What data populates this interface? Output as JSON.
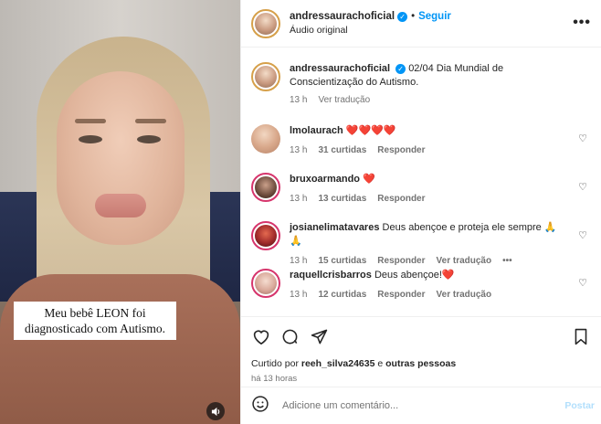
{
  "video": {
    "caption_line1": "Meu bebê LEON foi",
    "caption_line2": "diagnosticado com Autismo.",
    "sound_icon": "speaker-icon"
  },
  "header": {
    "username": "andressaurachoficial",
    "separator": "•",
    "follow_label": "Seguir",
    "audio_label": "Áudio original",
    "more_label": "•••"
  },
  "post": {
    "username": "andressaurachoficial",
    "text": "02/04 Dia Mundial de Conscientização do Autismo.",
    "time": "13 h",
    "translate": "Ver tradução"
  },
  "comments": [
    {
      "user": "lmolaurach",
      "text": "❤️❤️❤️❤️",
      "time": "13 h",
      "likes": "31 curtidas",
      "reply": "Responder",
      "translate": ""
    },
    {
      "user": "bruxoarmando",
      "text": "❤️",
      "time": "13 h",
      "likes": "13 curtidas",
      "reply": "Responder",
      "translate": ""
    },
    {
      "user": "josianelimatavares",
      "text": "Deus abençoe e proteja ele sempre 🙏🙏",
      "time": "13 h",
      "likes": "15 curtidas",
      "reply": "Responder",
      "translate": "Ver tradução",
      "more": "•••"
    },
    {
      "user": "raquellcrisbarros",
      "text": "Deus abençoe!❤️",
      "time": "13 h",
      "likes": "12 curtidas",
      "reply": "Responder",
      "translate": "Ver tradução"
    }
  ],
  "actions": {
    "like_icon": "heart-icon",
    "comment_icon": "comment-icon",
    "share_icon": "share-icon",
    "save_icon": "bookmark-icon",
    "liked_prefix": "Curtido por",
    "liked_user": "reeh_silva24635",
    "liked_conj": "e",
    "liked_others": "outras pessoas",
    "time_ago": "há 13 horas"
  },
  "add_comment": {
    "placeholder": "Adicione um comentário...",
    "post_label": "Postar",
    "emoji_icon": "emoji-icon"
  },
  "colors": {
    "link_blue": "#0095f6",
    "verified_blue": "#0095f6",
    "meta_gray": "#737373",
    "heart_red": "#e0245e"
  }
}
